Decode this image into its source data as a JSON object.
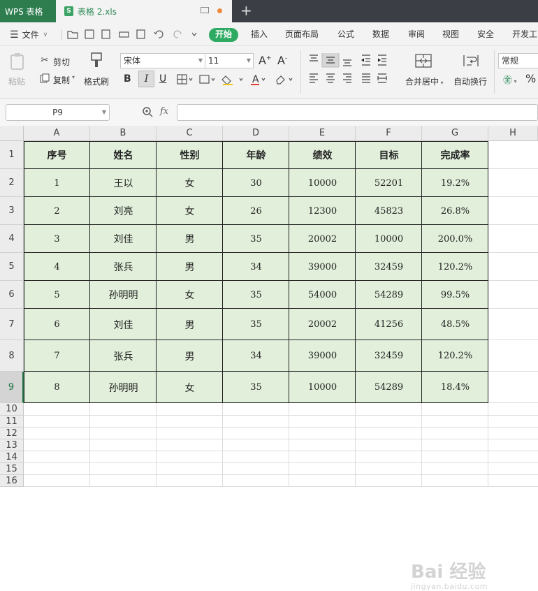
{
  "app": {
    "tab_label": "WPS 表格"
  },
  "document": {
    "tab_label": "表格 2.xls",
    "file_badge": "S"
  },
  "titlebar": {
    "new_tab": "+"
  },
  "menu": {
    "file": "文件",
    "items": [
      "开始",
      "插入",
      "页面布局",
      "公式",
      "数据",
      "审阅",
      "视图",
      "安全",
      "开发工"
    ],
    "active": "开始"
  },
  "ribbon": {
    "paste": "粘贴",
    "cut": "剪切",
    "copy": "复制",
    "format_painter": "格式刷",
    "font_name": "宋体",
    "font_size": "11",
    "bold": "B",
    "italic": "I",
    "underline": "U",
    "merge_center": "合并居中",
    "wrap_text": "自动换行",
    "number_format": "常规",
    "percent": "%"
  },
  "formula_bar": {
    "name_box": "P9",
    "fx": "fx",
    "formula": ""
  },
  "columns": [
    "A",
    "B",
    "C",
    "D",
    "E",
    "F",
    "G",
    "H"
  ],
  "rows": [
    "1",
    "2",
    "3",
    "4",
    "5",
    "6",
    "7",
    "8",
    "9",
    "10",
    "11",
    "12",
    "13",
    "14",
    "15",
    "16"
  ],
  "selected_row": "9",
  "table": {
    "headers": [
      "序号",
      "姓名",
      "性别",
      "年龄",
      "绩效",
      "目标",
      "完成率"
    ],
    "rows": [
      [
        "1",
        "王以",
        "女",
        "30",
        "10000",
        "52201",
        "19.2%"
      ],
      [
        "2",
        "刘亮",
        "女",
        "26",
        "12300",
        "45823",
        "26.8%"
      ],
      [
        "3",
        "刘佳",
        "男",
        "35",
        "20002",
        "10000",
        "200.0%"
      ],
      [
        "4",
        "张兵",
        "男",
        "34",
        "39000",
        "32459",
        "120.2%"
      ],
      [
        "5",
        "孙明明",
        "女",
        "35",
        "54000",
        "54289",
        "99.5%"
      ],
      [
        "6",
        "刘佳",
        "男",
        "35",
        "20002",
        "41256",
        "48.5%"
      ],
      [
        "7",
        "张兵",
        "男",
        "34",
        "39000",
        "32459",
        "120.2%"
      ],
      [
        "8",
        "孙明明",
        "女",
        "35",
        "10000",
        "54289",
        "18.4%"
      ]
    ]
  },
  "colors": {
    "accent": "#2eaa62",
    "table_fill": "#e2efdb",
    "app_tab": "#2e7d4f"
  },
  "watermark": {
    "main": "Bai 经验",
    "sub": "jingyan.baidu.com"
  }
}
